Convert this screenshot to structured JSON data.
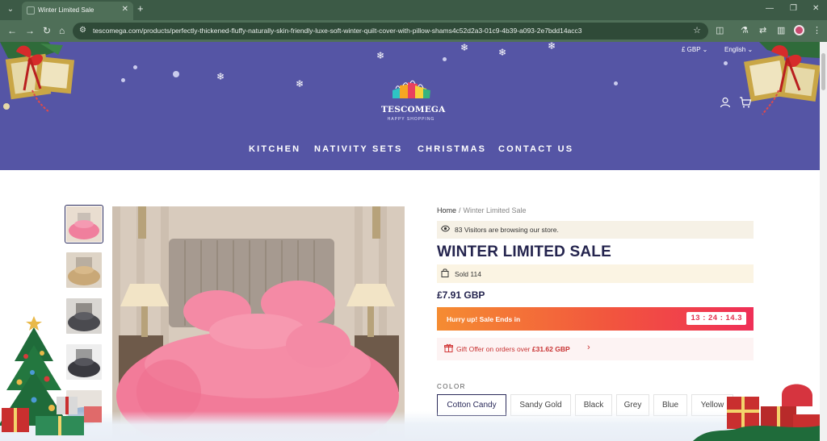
{
  "browser": {
    "tab_title": "Winter Limited Sale",
    "url": "tescomega.com/products/perfectly-thickened-fluffy-naturally-skin-friendly-luxe-soft-winter-quilt-cover-with-pillow-shams4c52d2a3-01c9-4b39-a093-2e7bdd14acc3",
    "accent": "#4f6f58"
  },
  "header": {
    "currency": "£ GBP",
    "language": "English",
    "logo_name": "TESCOMEGA",
    "logo_tagline": "HAPPY SHOPPING",
    "bg_color": "#5555a5",
    "nav": [
      "KITCHEN",
      "NATIVITY SETS",
      "CHRISTMAS",
      "CONTACT US"
    ]
  },
  "product": {
    "breadcrumb": {
      "home": "Home",
      "separator": "/",
      "current": "Winter Limited Sale"
    },
    "visitors_text": "83 Visitors are browsing our store.",
    "title": "WINTER LIMITED SALE",
    "sold_text": "Sold 114",
    "price": "£7.91 GBP",
    "countdown": {
      "label": "Hurry up! Sale Ends in",
      "time": "13 : 24 : 14.3"
    },
    "gift_offer": {
      "prefix": "Gift Offer on orders over",
      "amount": "£31.62 GBP"
    },
    "color_label": "COLOR",
    "colors": [
      "Cotton Candy",
      "Sandy Gold",
      "Black",
      "Grey",
      "Blue",
      "Yellow"
    ],
    "selected_color": "Cotton Candy",
    "theme_color": "#24244e",
    "sale_gradient": [
      "#f58c32",
      "#ef2f57"
    ]
  }
}
